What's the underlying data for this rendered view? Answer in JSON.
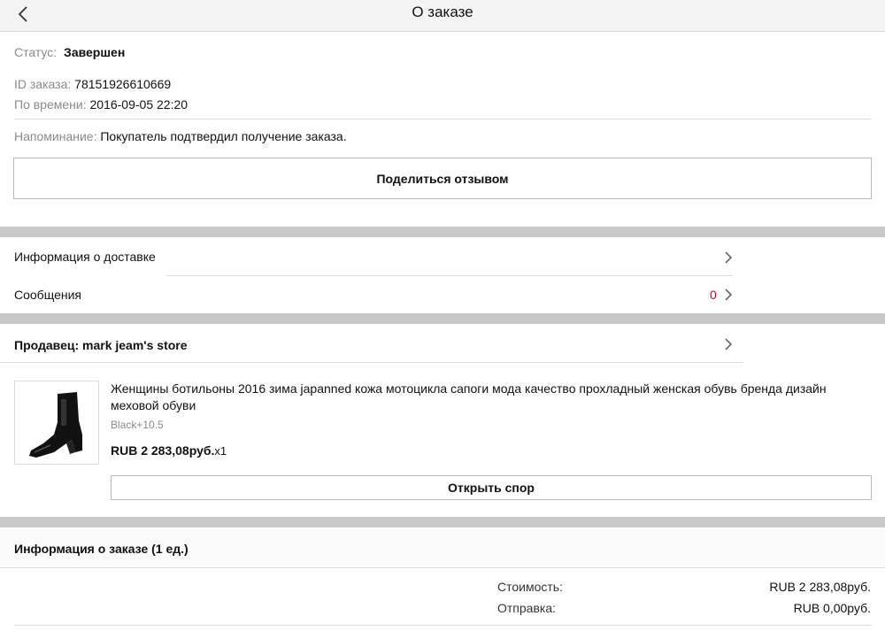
{
  "header": {
    "title": "О заказе"
  },
  "status": {
    "status_label": "Статус:",
    "status_value": "Завершен",
    "id_label": "ID заказа:",
    "id_value": "78151926610669",
    "time_label": "По времени:",
    "time_value": "2016-09-05 22:20",
    "reminder_label": "Напоминание:",
    "reminder_value": "Покупатель подтвердил получение заказа.",
    "review_button": "Поделиться отзывом"
  },
  "nav": {
    "delivery_label": "Информация о доставке",
    "messages_label": "Сообщения",
    "messages_count": "0"
  },
  "seller": {
    "label": "Продавец: mark jeam's store"
  },
  "product": {
    "title": "Женщины ботильоны 2016 зима japanned кожа мотоцикла сапоги мода качество прохладный женская обувь бренда дизайн меховой обуви",
    "variant": "Black+10.5",
    "price": "RUB 2 283,08руб.",
    "qty": "x1",
    "dispute_button": "Открыть спор"
  },
  "order_info": {
    "title": "Информация о заказе (1 ед.)",
    "cost_label": "Стоимость:",
    "cost_value": "RUB 2 283,08руб.",
    "shipping_label": "Отправка:",
    "shipping_value": "RUB 0,00руб."
  },
  "colors": {
    "accent_count": "#d0021b",
    "separator_bar": "#c8c8c8",
    "label_gray": "#8a8a8a"
  }
}
